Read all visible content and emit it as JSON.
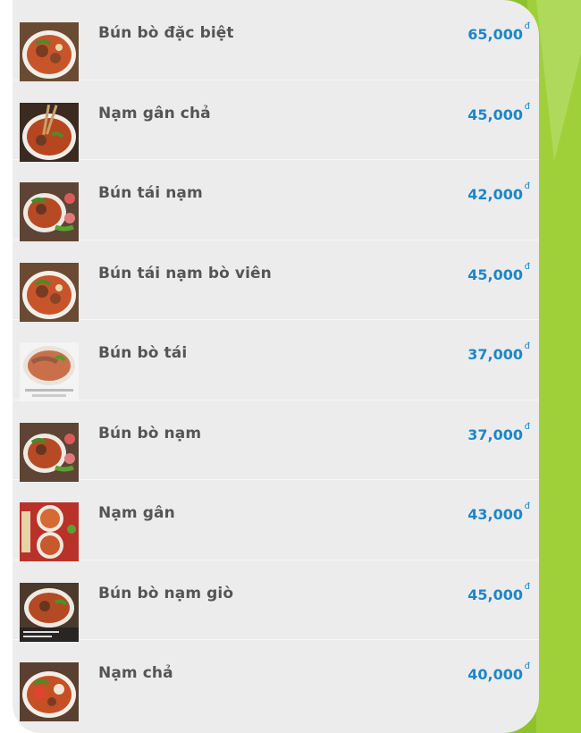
{
  "colors": {
    "panel": "#ececec",
    "accent_green": "#8ec22c",
    "price_blue": "#1f86c8",
    "name_gray": "#555555"
  },
  "menu": {
    "items": [
      {
        "name": "Bún bò đặc biệt",
        "price": "65,000",
        "currency": "đ",
        "thumb_icon": "beef-noodle-bowl"
      },
      {
        "name": "Nạm gân chả",
        "price": "45,000",
        "currency": "đ",
        "thumb_icon": "beef-noodle-bowl-chopsticks"
      },
      {
        "name": "Bún tái nạm",
        "price": "42,000",
        "currency": "đ",
        "thumb_icon": "beef-noodle-bowl-herbs"
      },
      {
        "name": "Bún tái nạm bò viên",
        "price": "45,000",
        "currency": "đ",
        "thumb_icon": "beef-noodle-bowl"
      },
      {
        "name": "Bún bò tái",
        "price": "37,000",
        "currency": "đ",
        "thumb_icon": "rare-beef-noodle-bowl"
      },
      {
        "name": "Bún bò nạm",
        "price": "37,000",
        "currency": "đ",
        "thumb_icon": "beef-noodle-bowl-herbs"
      },
      {
        "name": "Nạm gân",
        "price": "43,000",
        "currency": "đ",
        "thumb_icon": "two-bowls"
      },
      {
        "name": "Bún bò nạm giò",
        "price": "45,000",
        "currency": "đ",
        "thumb_icon": "beef-noodle-bowl-caption"
      },
      {
        "name": "Nạm chả",
        "price": "40,000",
        "currency": "đ",
        "thumb_icon": "beef-noodle-bowl-tomato"
      }
    ]
  }
}
